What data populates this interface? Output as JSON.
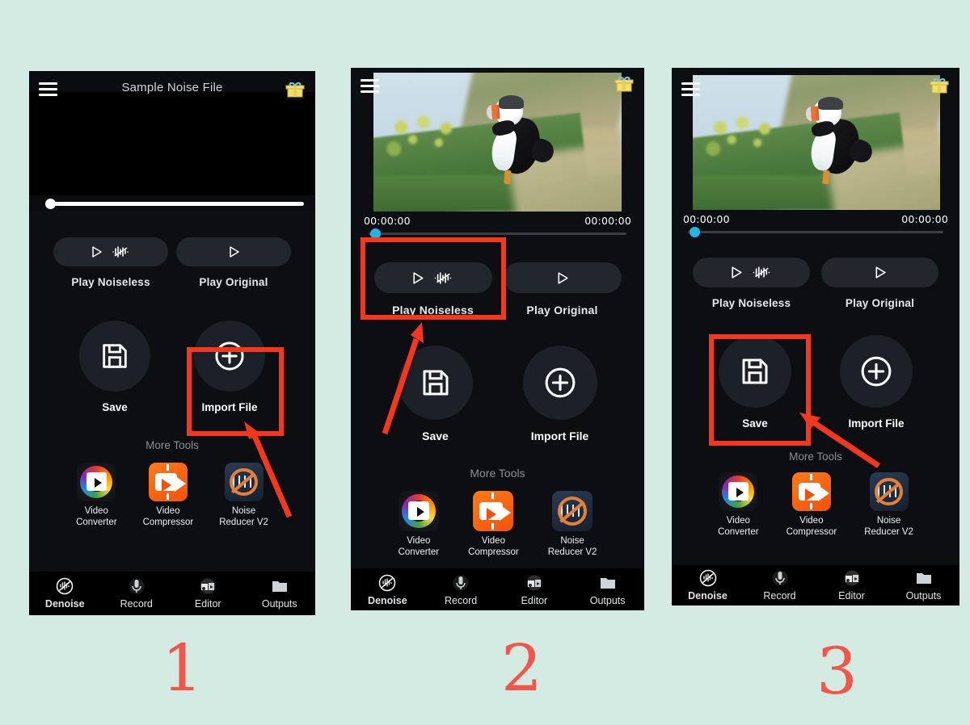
{
  "background_color": "#d3ebe3",
  "accent_red": "#f4371e",
  "step_number_color": "#f2564a",
  "steps": [
    {
      "number": "1"
    },
    {
      "number": "2"
    },
    {
      "number": "3"
    }
  ],
  "panels": [
    {
      "id": "panel-1",
      "menu_icon": "hamburger-menu-icon",
      "gift_icon": "gift-box-icon",
      "video_title": "Sample Noise File",
      "has_thumbnail": false,
      "timeline": {
        "current_time": "",
        "total_time": ""
      },
      "play_buttons": [
        {
          "label": "Play Noiseless",
          "icon": "play-noiseless-icon"
        },
        {
          "label": "Play Original",
          "icon": "play-icon"
        }
      ],
      "action_buttons": [
        {
          "label": "Save",
          "icon": "save-floppy-icon"
        },
        {
          "label": "Import File",
          "icon": "plus-circle-icon"
        }
      ],
      "more_tools_label": "More Tools",
      "tools": [
        {
          "label_line1": "Video",
          "label_line2": "Converter",
          "icon": "video-converter-icon"
        },
        {
          "label_line1": "Video",
          "label_line2": "Compressor",
          "icon": "video-compressor-icon"
        },
        {
          "label_line1": "Noise",
          "label_line2": "Reducer V2",
          "icon": "noise-reducer-icon"
        }
      ],
      "nav": [
        {
          "label": "Denoise",
          "icon": "denoise-icon"
        },
        {
          "label": "Record",
          "icon": "microphone-icon"
        },
        {
          "label": "Editor",
          "icon": "editor-icon"
        },
        {
          "label": "Outputs",
          "icon": "folder-icon"
        }
      ],
      "highlight_target": "Import File"
    },
    {
      "id": "panel-2",
      "menu_icon": "hamburger-menu-icon",
      "gift_icon": "gift-box-icon",
      "video_title": "",
      "has_thumbnail": true,
      "timeline": {
        "current_time": "00:00:00",
        "total_time": "00:00:00"
      },
      "play_buttons": [
        {
          "label": "Play Noiseless",
          "icon": "play-noiseless-icon"
        },
        {
          "label": "Play Original",
          "icon": "play-icon"
        }
      ],
      "action_buttons": [
        {
          "label": "Save",
          "icon": "save-floppy-icon"
        },
        {
          "label": "Import File",
          "icon": "plus-circle-icon"
        }
      ],
      "more_tools_label": "More Tools",
      "tools": [
        {
          "label_line1": "Video",
          "label_line2": "Converter",
          "icon": "video-converter-icon"
        },
        {
          "label_line1": "Video",
          "label_line2": "Compressor",
          "icon": "video-compressor-icon"
        },
        {
          "label_line1": "Noise",
          "label_line2": "Reducer V2",
          "icon": "noise-reducer-icon"
        }
      ],
      "nav": [
        {
          "label": "Denoise",
          "icon": "denoise-icon"
        },
        {
          "label": "Record",
          "icon": "microphone-icon"
        },
        {
          "label": "Editor",
          "icon": "editor-icon"
        },
        {
          "label": "Outputs",
          "icon": "folder-icon"
        }
      ],
      "highlight_target": "Play Noiseless"
    },
    {
      "id": "panel-3",
      "menu_icon": "hamburger-menu-icon",
      "gift_icon": "gift-box-icon",
      "video_title": "",
      "has_thumbnail": true,
      "timeline": {
        "current_time": "00:00:00",
        "total_time": "00:00:00"
      },
      "play_buttons": [
        {
          "label": "Play Noiseless",
          "icon": "play-noiseless-icon"
        },
        {
          "label": "Play Original",
          "icon": "play-icon"
        }
      ],
      "action_buttons": [
        {
          "label": "Save",
          "icon": "save-floppy-icon"
        },
        {
          "label": "Import File",
          "icon": "plus-circle-icon"
        }
      ],
      "more_tools_label": "More Tools",
      "tools": [
        {
          "label_line1": "Video",
          "label_line2": "Converter",
          "icon": "video-converter-icon"
        },
        {
          "label_line1": "Video",
          "label_line2": "Compressor",
          "icon": "video-compressor-icon"
        },
        {
          "label_line1": "Noise",
          "label_line2": "Reducer V2",
          "icon": "noise-reducer-icon"
        }
      ],
      "nav": [
        {
          "label": "Denoise",
          "icon": "denoise-icon"
        },
        {
          "label": "Record",
          "icon": "microphone-icon"
        },
        {
          "label": "Editor",
          "icon": "editor-icon"
        },
        {
          "label": "Outputs",
          "icon": "folder-icon"
        }
      ],
      "highlight_target": "Save"
    }
  ]
}
